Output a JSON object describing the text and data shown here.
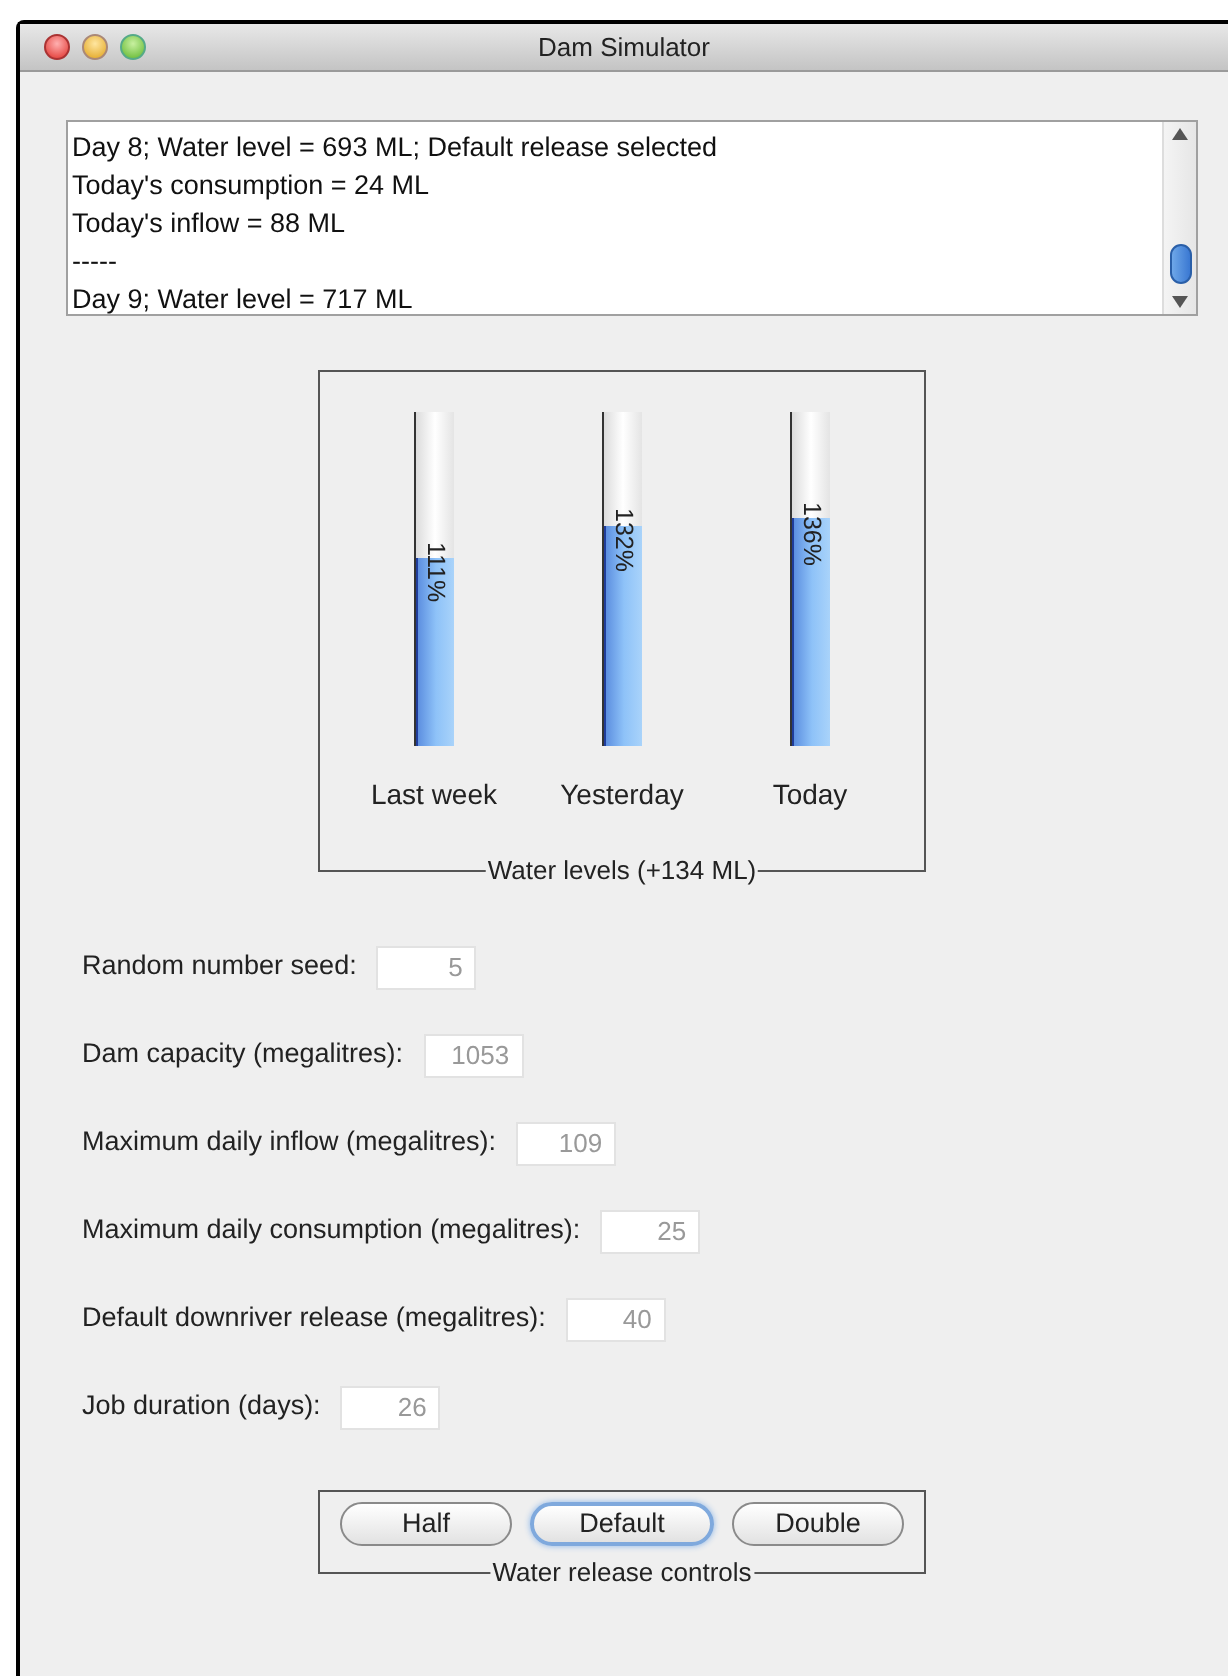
{
  "window": {
    "title": "Dam Simulator"
  },
  "log": {
    "lines": [
      "Day 8; Water level = 693 ML; Default release selected",
      "Today's consumption = 24 ML",
      "Today's inflow = 88 ML",
      "-----",
      "Day 9; Water level = 717 ML"
    ]
  },
  "chart": {
    "title": "Water levels (+134 ML)",
    "bars": [
      {
        "label": "Last week",
        "reading": "111%",
        "level": 0.56
      },
      {
        "label": "Yesterday",
        "reading": "132%",
        "level": 0.66
      },
      {
        "label": "Today",
        "reading": "136%",
        "level": 0.68
      }
    ]
  },
  "fields": [
    {
      "label": "Random number seed:",
      "value": "5"
    },
    {
      "label": "Dam capacity (megalitres):",
      "value": "1053"
    },
    {
      "label": "Maximum daily inflow (megalitres):",
      "value": "109"
    },
    {
      "label": "Maximum daily consumption (megalitres):",
      "value": "25"
    },
    {
      "label": "Default downriver release (megalitres):",
      "value": "40"
    },
    {
      "label": "Job duration (days):",
      "value": "26"
    }
  ],
  "release_controls": {
    "title": "Water release controls",
    "buttons": [
      {
        "label": "Half",
        "focused": false
      },
      {
        "label": "Default",
        "focused": true
      },
      {
        "label": "Double",
        "focused": false
      }
    ]
  }
}
